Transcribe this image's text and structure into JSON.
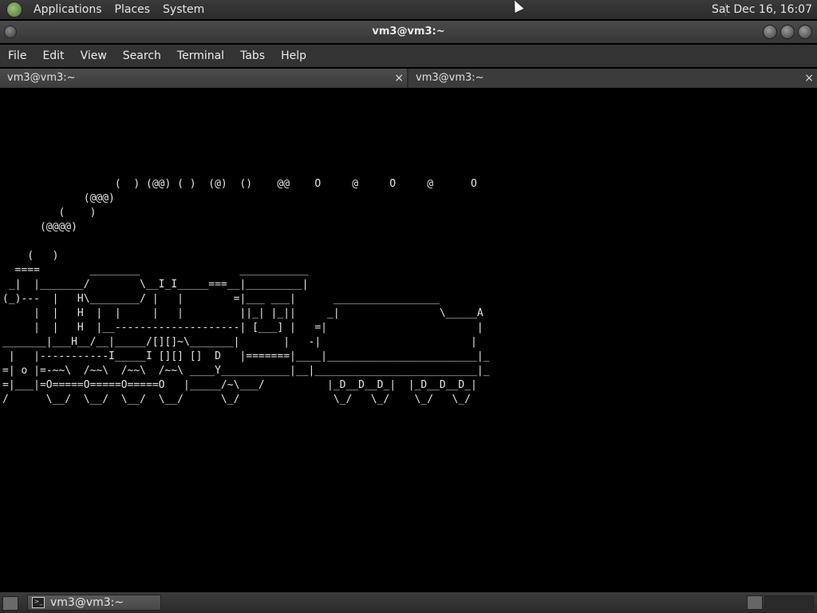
{
  "top_panel": {
    "menus": [
      "Applications",
      "Places",
      "System"
    ],
    "clock": "Sat Dec 16, 16:07"
  },
  "window": {
    "title": "vm3@vm3:~"
  },
  "menubar": {
    "items": [
      "File",
      "Edit",
      "View",
      "Search",
      "Terminal",
      "Tabs",
      "Help"
    ]
  },
  "tabs": [
    {
      "label": "vm3@vm3:~",
      "close": "×"
    },
    {
      "label": "vm3@vm3:~",
      "close": "×"
    }
  ],
  "terminal": {
    "text": "                  (  ) (@@) ( )  (@)  ()    @@    O     @     O     @      O\n             (@@@)\n         (    )\n      (@@@@)\n\n    (   )\n  ====        ________                ___________\n _|  |_______/        \\__I_I_____===__|_________|\n(_)---  |   H\\________/ |   |        =|___ ___|      _________________\n     |  |   H  |  |     |   |         ||_| |_||     _|                \\_____A\n     |  |   H  |__--------------------| [___] |   =|                        |\n_______|___H__/__|_____/[][]~\\_______|       |   -|                        |\n |   |-----------I_____I [][] []  D   |=======|____|________________________|_\n=| o |=-~~\\  /~~\\  /~~\\  /~~\\ ____Y___________|__|__________________________|_\n=|___|=O=====O=====O=====O   |_____/~\\___/          |_D__D__D_|  |_D__D__D_|\n/      \\__/  \\__/  \\__/  \\__/      \\_/               \\_/   \\_/    \\_/   \\_/"
  },
  "taskbar": {
    "task_label": "vm3@vm3:~"
  },
  "colors": {
    "panel_bg": "#2b2b2b",
    "terminal_bg": "#000000",
    "terminal_fg": "#e6e6e6"
  }
}
